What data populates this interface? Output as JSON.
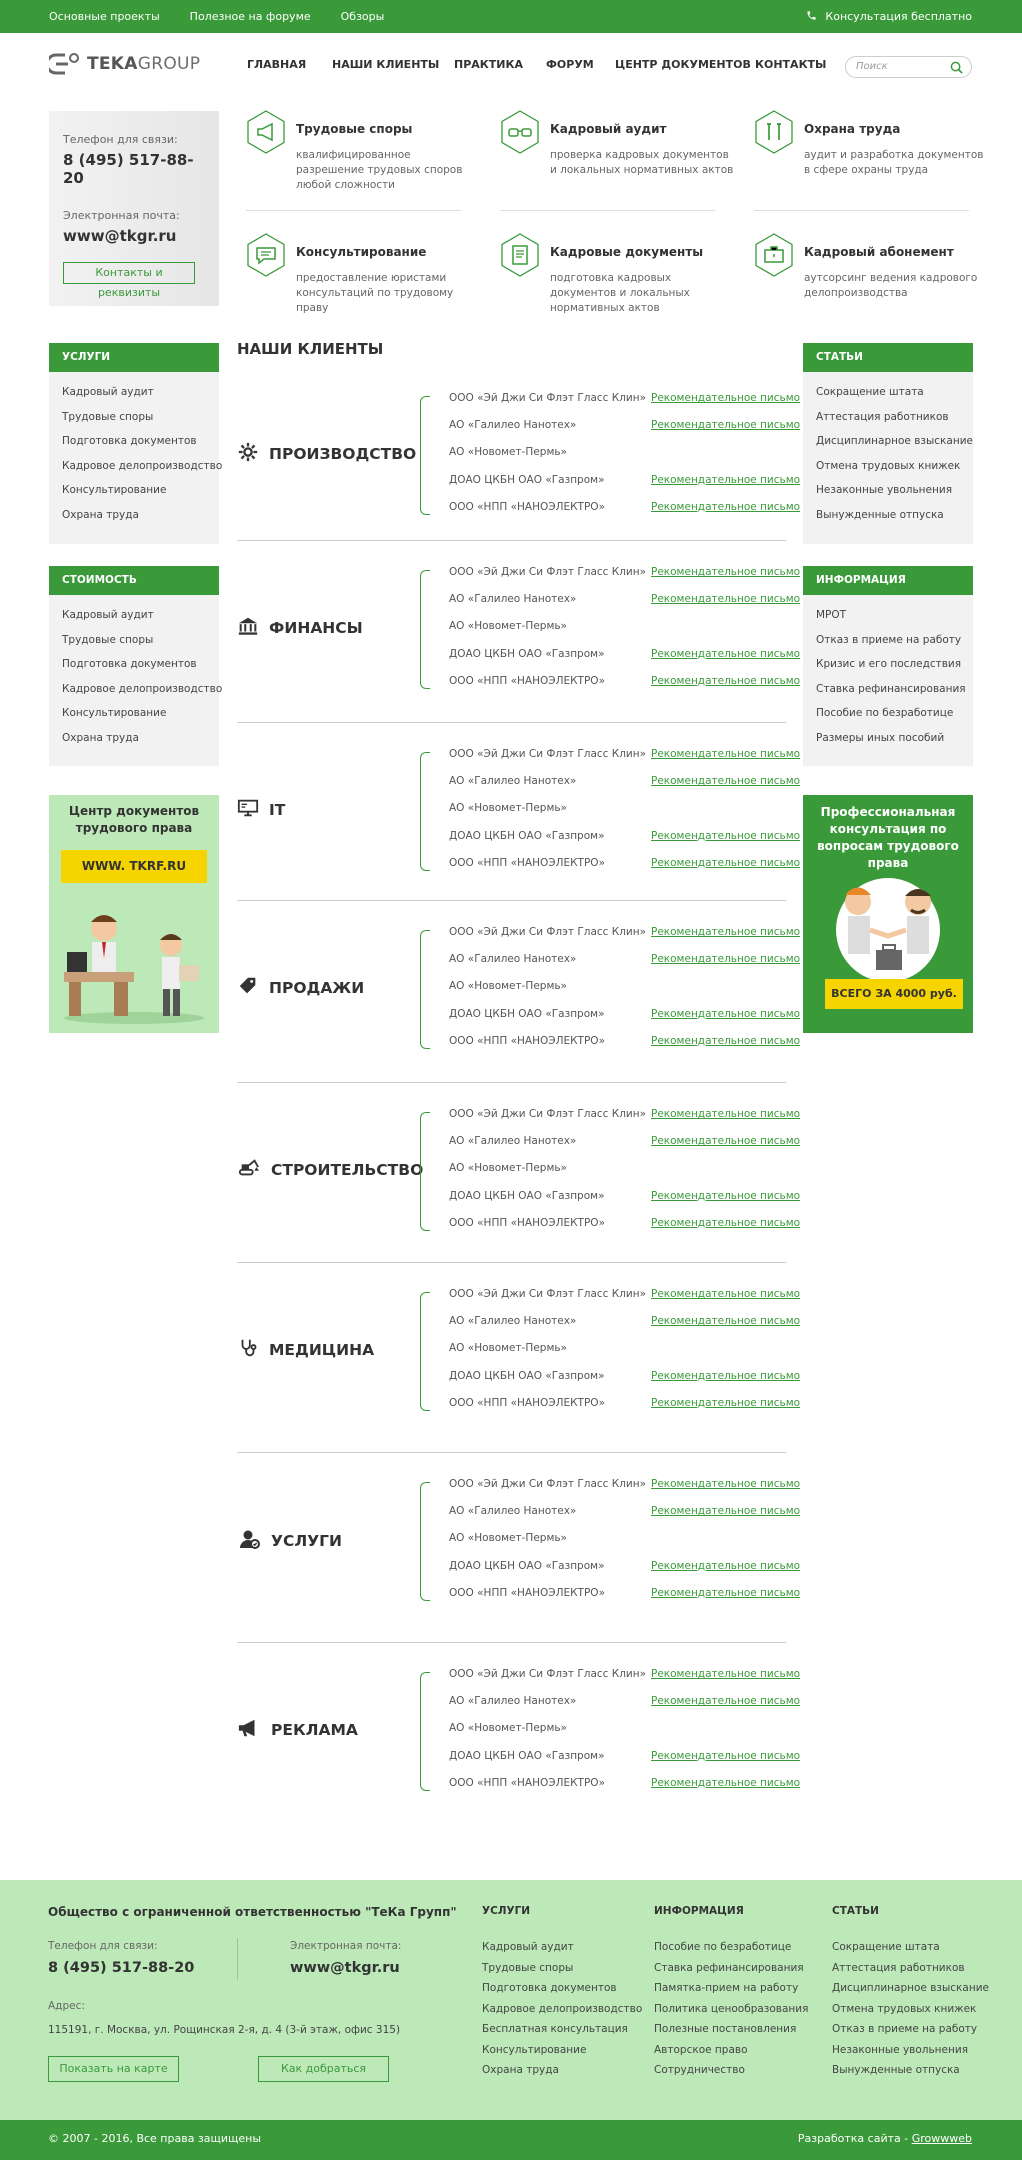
{
  "topbar": {
    "links": [
      "Основные проекты",
      "Полезное на форуме",
      "Обзоры"
    ],
    "consult": "Консультация бесплатно"
  },
  "logo": {
    "part1": "TEKA",
    "part2": "GROUP"
  },
  "nav": [
    "ГЛАВНАЯ",
    "НАШИ КЛИЕНТЫ",
    "ПРАКТИКА",
    "ФОРУМ",
    "ЦЕНТР ДОКУМЕНТОВ",
    "КОНТАКТЫ"
  ],
  "search": {
    "placeholder": "Поиск"
  },
  "contact": {
    "phone_label": "Телефон для связи:",
    "phone": "8 (495) 517-88-20",
    "email_label": "Электронная почта:",
    "email": "www@tkgr.ru",
    "button": "Контакты и реквизиты"
  },
  "services": [
    {
      "title": "Трудовые споры",
      "desc": "квалифицированное разрешение трудовых споров любой сложности",
      "icon": "megaphone-icon"
    },
    {
      "title": "Кадровый аудит",
      "desc": "проверка кадровых документов и локальных нормативных актов",
      "icon": "glasses-icon"
    },
    {
      "title": "Охрана труда",
      "desc": "аудит и разработка документов в сфере охраны труда",
      "icon": "tools-icon"
    },
    {
      "title": "Консультирование",
      "desc": "предоставление юристами консультаций по трудовому праву",
      "icon": "chat-icon"
    },
    {
      "title": "Кадровые документы",
      "desc": "подготовка кадровых документов и локальных нормативных актов",
      "icon": "document-icon"
    },
    {
      "title": "Кадровый абонемент",
      "desc": "аутсорсинг ведения кадрового делопроизводства",
      "icon": "briefcase-icon"
    }
  ],
  "left_menu1": {
    "title": "УСЛУГИ",
    "items": [
      "Кадровый аудит",
      "Трудовые споры",
      "Подготовка документов",
      "Кадровое делопроизводство",
      "Консультирование",
      "Охрана труда"
    ]
  },
  "left_menu2": {
    "title": "СТОИМОСТЬ",
    "items": [
      "Кадровый аудит",
      "Трудовые споры",
      "Подготовка документов",
      "Кадровое делопроизводство",
      "Консультирование",
      "Охрана труда"
    ]
  },
  "right_menu1": {
    "title": "СТАТЬИ",
    "items": [
      "Сокращение штата",
      "Аттестация работников",
      "Дисциплинарное взыскание",
      "Отмена трудовых книжек",
      "Незаконные увольнения",
      "Вынужденные отпуска"
    ]
  },
  "right_menu2": {
    "title": "ИНФОРМАЦИЯ",
    "items": [
      "МРОТ",
      "Отказ в приеме на работу",
      "Кризис и его последствия",
      "Ставка рефинансирования",
      "Пособие по безработице",
      "Размеры иных пособий"
    ]
  },
  "promo_left": {
    "title": "Центр документов трудового права",
    "badge": "WWW. TKRF.RU"
  },
  "promo_right": {
    "title": "Профессиональная консультация по вопросам трудового права",
    "badge": "ВСЕГО ЗА 4000 руб."
  },
  "clients_title": "НАШИ КЛИЕНТЫ",
  "clients_list": [
    "ООО «Эй Джи Си Флэт Гласс Клин»",
    "АО «Галилео Нанотех»",
    "АО «Новомет-Пермь»",
    "ДОАО ЦКБН ОАО «Газпром»",
    "ООО «НПП «НАНОЭЛЕКТРО»"
  ],
  "letter_text": "Рекомендательное письмо",
  "categories": [
    {
      "name": "ПРОИЗВОДСТВО",
      "icon": "gear-icon"
    },
    {
      "name": "ФИНАНСЫ",
      "icon": "bank-icon"
    },
    {
      "name": "IT",
      "icon": "computer-icon"
    },
    {
      "name": "ПРОДАЖИ",
      "icon": "tag-icon"
    },
    {
      "name": "СТРОИТЕЛЬСТВО",
      "icon": "excavator-icon"
    },
    {
      "name": "МЕДИЦИНА",
      "icon": "stethoscope-icon"
    },
    {
      "name": "УСЛУГИ",
      "icon": "person-icon"
    },
    {
      "name": "РЕКЛАМА",
      "icon": "megaphone-icon"
    }
  ],
  "footer": {
    "org": "Общество с ограниченной ответственностью \"ТеКа Групп\"",
    "phone_label": "Телефон для связи:",
    "phone": "8 (495) 517-88-20",
    "email_label": "Электронная почта:",
    "email": "www@tkgr.ru",
    "address_label": "Адрес:",
    "address": "115191, г. Москва, ул. Рощинская 2-я, д. 4 (3-й этаж, офис 315)",
    "btn_map": "Показать на карте",
    "btn_route": "Как добраться",
    "col1": {
      "title": "УСЛУГИ",
      "items": [
        "Кадровый аудит",
        "Трудовые споры",
        "Подготовка документов",
        "Кадровое делопроизводство",
        "Бесплатная консультация",
        "Консультирование",
        "Охрана труда"
      ]
    },
    "col2": {
      "title": "ИНФОРМАЦИЯ",
      "items": [
        "Пособие по безработице",
        "Ставка рефинансирования",
        "Памятка-прием на работу",
        "Политика ценообразования",
        "Полезные постановления",
        "Авторское право",
        "Сотрудничество"
      ]
    },
    "col3": {
      "title": "СТАТЬИ",
      "items": [
        "Сокращение штата",
        "Аттестация работников",
        "Дисциплинарное взыскание",
        "Отмена трудовых книжек",
        "Отказ в приеме на работу",
        "Незаконные увольнения",
        "Вынужденные отпуска"
      ]
    }
  },
  "bottombar": {
    "copyright": "© 2007 - 2016, Все права защищены",
    "dev_label": "Разработка сайта -",
    "dev_link": "Growwweb"
  },
  "colors": {
    "green": "#3a9a3a",
    "light_green": "#bde9b9",
    "yellow": "#f5d400"
  }
}
